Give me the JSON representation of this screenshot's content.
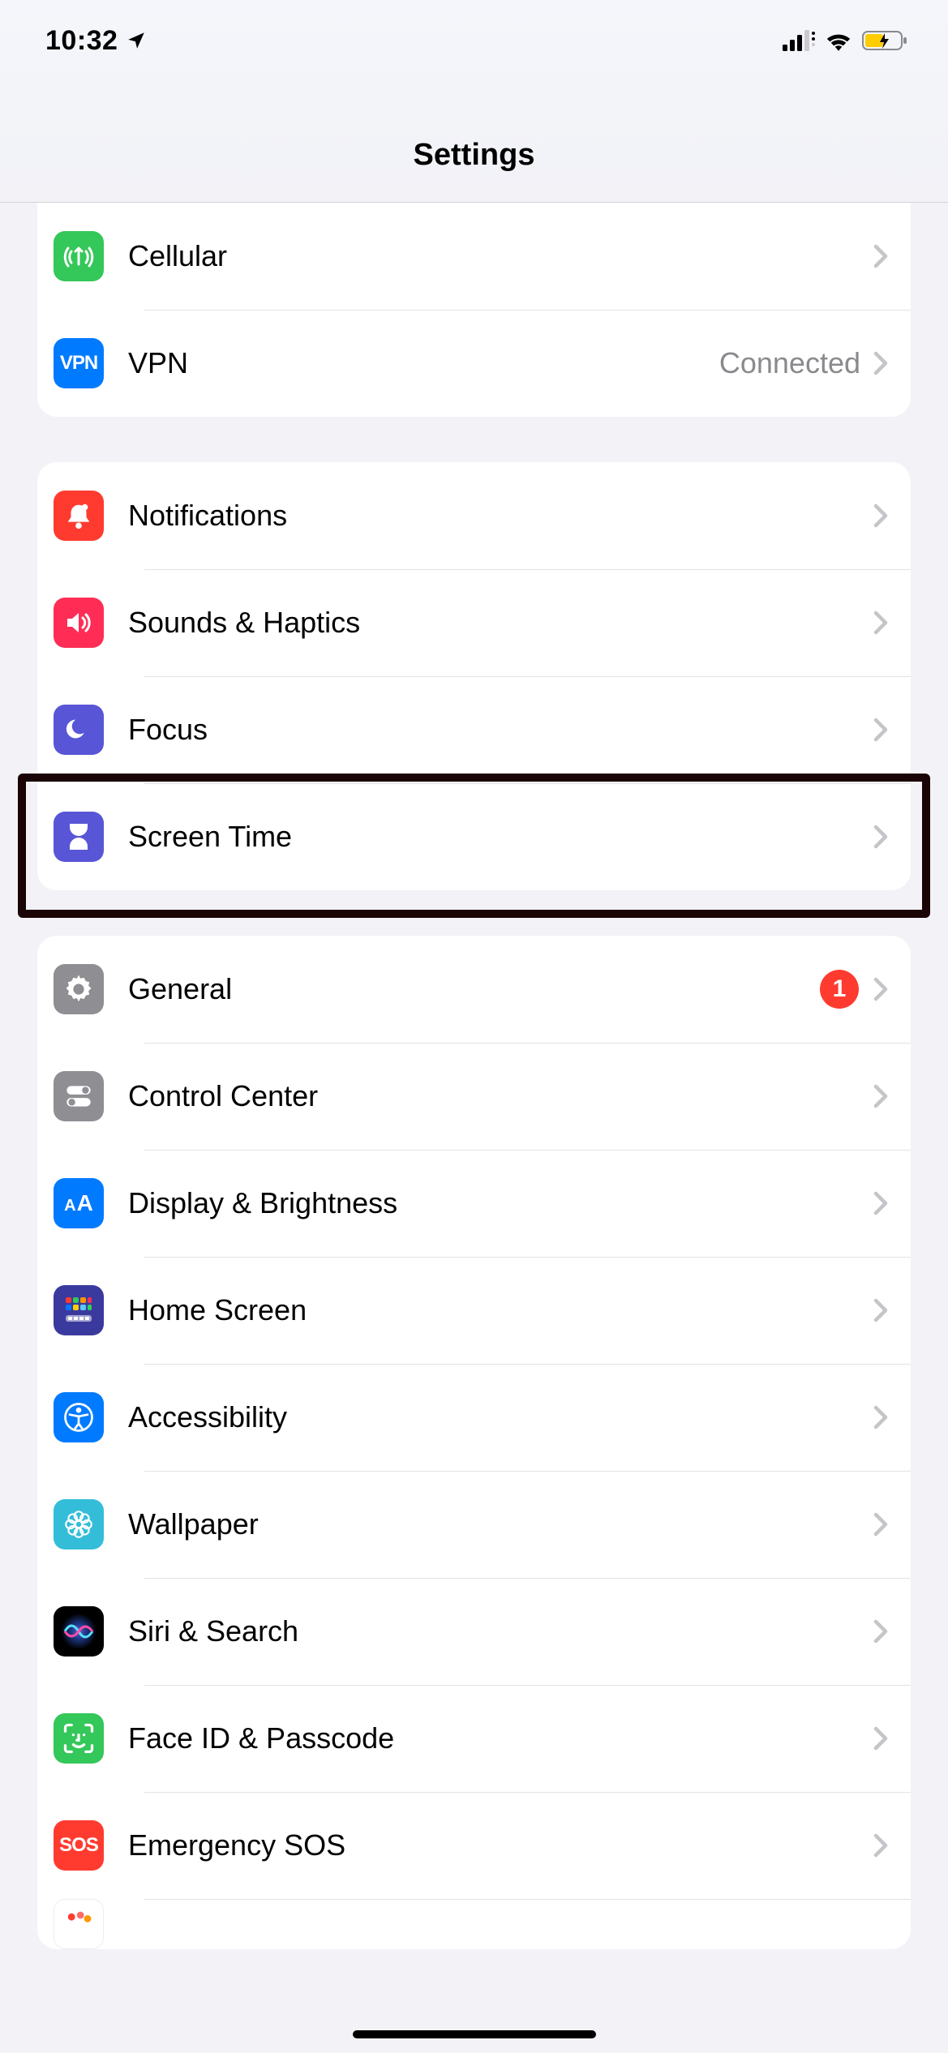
{
  "status": {
    "time": "10:32"
  },
  "page": {
    "title": "Settings"
  },
  "groups": [
    {
      "id": "connectivity-cont",
      "first": true,
      "rows": [
        {
          "id": "cellular",
          "label": "Cellular",
          "icon": "cellular-icon",
          "color": "#34c759"
        },
        {
          "id": "vpn",
          "label": "VPN",
          "icon": "vpn-icon",
          "color": "#007aff",
          "detail": "Connected"
        }
      ]
    },
    {
      "id": "attention",
      "rows": [
        {
          "id": "notifications",
          "label": "Notifications",
          "icon": "bell-icon",
          "color": "#ff3b30"
        },
        {
          "id": "sounds",
          "label": "Sounds & Haptics",
          "icon": "speaker-icon",
          "color": "#ff2d55"
        },
        {
          "id": "focus",
          "label": "Focus",
          "icon": "moon-icon",
          "color": "#5856d6"
        },
        {
          "id": "screentime",
          "label": "Screen Time",
          "icon": "hourglass-icon",
          "color": "#5856d6",
          "highlighted": true
        }
      ]
    },
    {
      "id": "device",
      "rows": [
        {
          "id": "general",
          "label": "General",
          "icon": "gear-icon",
          "color": "#8e8e93",
          "badge": "1"
        },
        {
          "id": "controlcenter",
          "label": "Control Center",
          "icon": "switches-icon",
          "color": "#8e8e93"
        },
        {
          "id": "display",
          "label": "Display & Brightness",
          "icon": "aa-icon",
          "color": "#007aff"
        },
        {
          "id": "homescreen",
          "label": "Home Screen",
          "icon": "home-grid-icon",
          "color": "#3a3a9e"
        },
        {
          "id": "accessibility",
          "label": "Accessibility",
          "icon": "accessibility-icon",
          "color": "#007aff"
        },
        {
          "id": "wallpaper",
          "label": "Wallpaper",
          "icon": "flower-icon",
          "color": "#33bdd8"
        },
        {
          "id": "siri",
          "label": "Siri & Search",
          "icon": "siri-icon",
          "color": "#000"
        },
        {
          "id": "faceid",
          "label": "Face ID & Passcode",
          "icon": "faceid-icon",
          "color": "#34c759"
        },
        {
          "id": "emergency",
          "label": "Emergency SOS",
          "icon": "sos-icon",
          "color": "#ff3b30"
        },
        {
          "id": "exposure",
          "label": "",
          "icon": "exposure-icon",
          "color": "#ffffff",
          "partial": true
        }
      ]
    }
  ]
}
